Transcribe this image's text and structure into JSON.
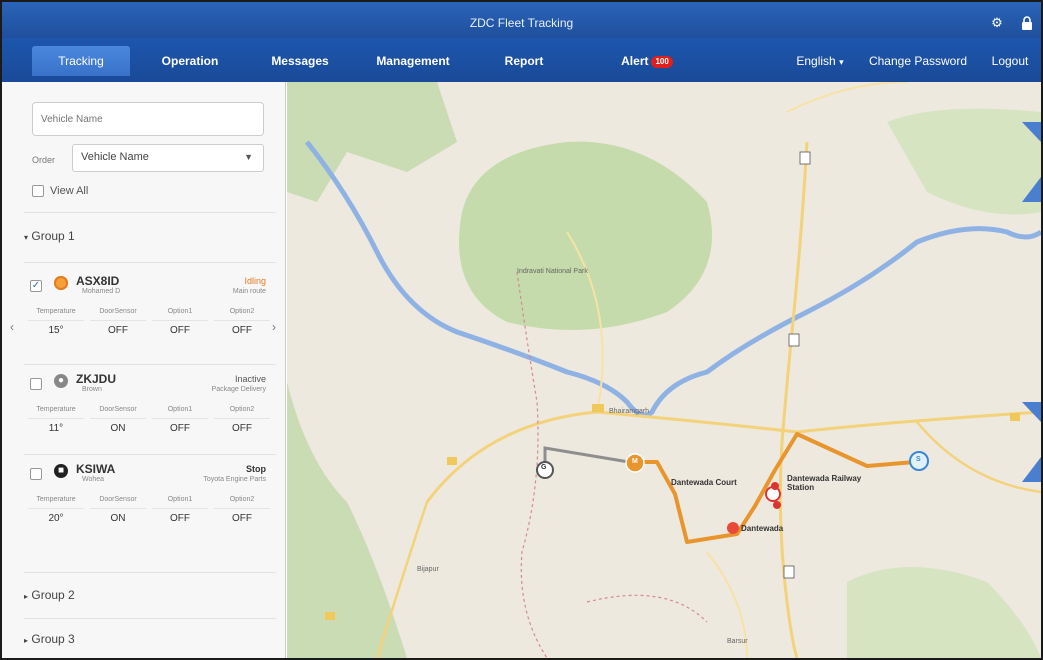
{
  "header": {
    "title": "ZDC Fleet Tracking",
    "settings_icon": "gear-icon",
    "lock_icon": "lock-icon"
  },
  "nav": {
    "tabs": [
      {
        "label": "Tracking",
        "active": true
      },
      {
        "label": "Operation"
      },
      {
        "label": "Messages"
      },
      {
        "label": "Management"
      },
      {
        "label": "Report"
      },
      {
        "label": "Alert"
      }
    ],
    "alert_badge": "100",
    "language": "English",
    "language_caret": "▾",
    "change_password": "Change Password",
    "logout": "Logout"
  },
  "sidebar": {
    "search_placeholder": "Vehicle Name",
    "order_label": "Order",
    "order_value": "Vehicle Name",
    "view_all": "View All",
    "groups": [
      {
        "label": "Group 1",
        "expanded": true
      },
      {
        "label": "Group 2",
        "expanded": false
      },
      {
        "label": "Group 3",
        "expanded": false
      }
    ],
    "vehicles": [
      {
        "name": "ASX8ID",
        "driver": "Mohamed D",
        "status": "Idling",
        "type": "Main route",
        "checked": true,
        "status_color": "#e87a1e",
        "icon": "vehicle-idle-icon",
        "sensors": [
          {
            "label": "Temperature",
            "value": "15°"
          },
          {
            "label": "DoorSensor",
            "value": "OFF"
          },
          {
            "label": "Option1",
            "value": "OFF"
          },
          {
            "label": "Option2",
            "value": "OFF"
          }
        ]
      },
      {
        "name": "ZKJDU",
        "driver": "Brown",
        "status": "Inactive",
        "type": "Package Delivery",
        "checked": false,
        "status_color": "#555555",
        "icon": "vehicle-inactive-icon",
        "sensors": [
          {
            "label": "Temperature",
            "value": "11°"
          },
          {
            "label": "DoorSensor",
            "value": "ON"
          },
          {
            "label": "Option1",
            "value": "OFF"
          },
          {
            "label": "Option2",
            "value": "OFF"
          }
        ]
      },
      {
        "name": "KSIWA",
        "driver": "Wohea",
        "status": "Stop",
        "type": "Toyota Engine Parts",
        "checked": false,
        "status_color": "#333333",
        "icon": "vehicle-stop-icon",
        "sensors": [
          {
            "label": "Temperature",
            "value": "20°"
          },
          {
            "label": "DoorSensor",
            "value": "ON"
          },
          {
            "label": "Option1",
            "value": "OFF"
          },
          {
            "label": "Option2",
            "value": "OFF"
          }
        ]
      }
    ]
  },
  "map": {
    "labels": {
      "park": "Indravati National Park",
      "bhairamgarh": "Bhairamgarh",
      "dantewada_court": "Dantewada Court",
      "dantewada_station": "Dantewada Railway Station",
      "dantewada": "Dantewada",
      "bijapur": "Bijapur",
      "barsur": "Barsur"
    },
    "route_color": "#e8952d",
    "marker_start": "S",
    "marker_end": "G",
    "marker_mid": "M"
  },
  "colors": {
    "header_blue": "#1f4f9d",
    "active_tab": "#3f7dd4",
    "idling": "#e87a1e"
  }
}
